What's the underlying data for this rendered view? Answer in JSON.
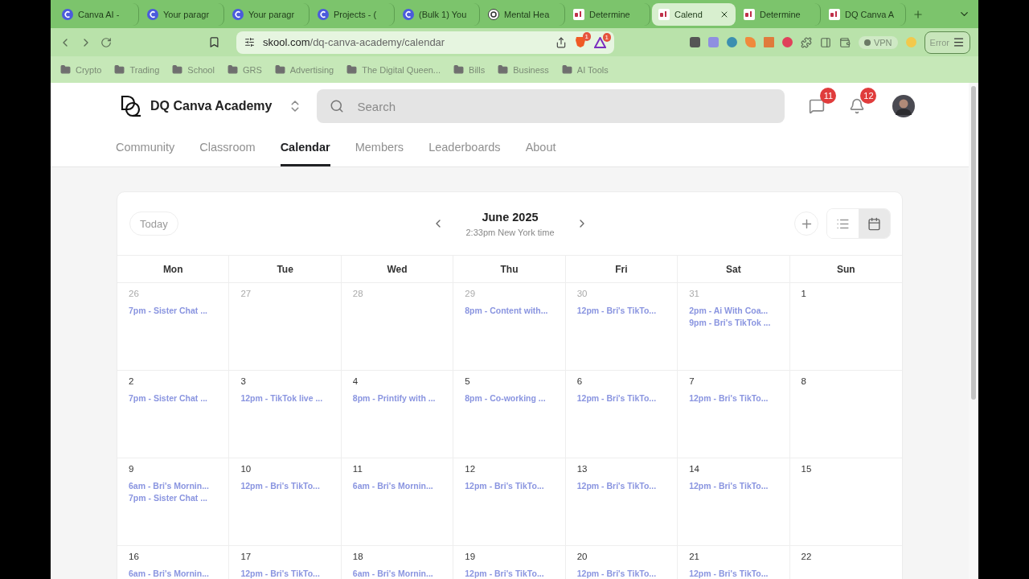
{
  "browser": {
    "tabs": [
      {
        "label": "Canva AI -",
        "kind": "circle",
        "selected": false
      },
      {
        "label": "Your paragr",
        "kind": "circle",
        "selected": false
      },
      {
        "label": "Your paragr",
        "kind": "circle",
        "selected": false
      },
      {
        "label": "Projects - (",
        "kind": "circle",
        "selected": false
      },
      {
        "label": "(Bulk 1) You",
        "kind": "circle",
        "selected": false
      },
      {
        "label": "Mental Hea",
        "kind": "swirl",
        "selected": false
      },
      {
        "label": "Determine",
        "kind": "square",
        "selected": false
      },
      {
        "label": "Calend",
        "kind": "square",
        "selected": true
      },
      {
        "label": "Determine",
        "kind": "square",
        "selected": false
      },
      {
        "label": "DQ Canva A",
        "kind": "square",
        "selected": false
      }
    ],
    "url_host": "skool.com",
    "url_path": "/dq-canva-academy/calendar",
    "shield_badge": "1",
    "rewards_badge": "1",
    "vpn_label": "VPN",
    "error_label": "Error",
    "bookmarks": [
      "Crypto",
      "Trading",
      "School",
      "GRS",
      "Advertising",
      "The Digital Queen...",
      "Bills",
      "Business",
      "AI Tools"
    ]
  },
  "header": {
    "group_name": "DQ Canva Academy",
    "search_placeholder": "Search",
    "chat_badge": "11",
    "notification_badge": "12"
  },
  "nav": [
    {
      "label": "Community",
      "selected": false
    },
    {
      "label": "Classroom",
      "selected": false
    },
    {
      "label": "Calendar",
      "selected": true
    },
    {
      "label": "Members",
      "selected": false
    },
    {
      "label": "Leaderboards",
      "selected": false
    },
    {
      "label": "About",
      "selected": false
    }
  ],
  "calendar": {
    "today_label": "Today",
    "month": "June 2025",
    "time_note": "2:33pm New York time",
    "views": [
      {
        "kind": "list",
        "selected": false
      },
      {
        "kind": "calendar",
        "selected": true
      }
    ],
    "weekdays": [
      "Mon",
      "Tue",
      "Wed",
      "Thu",
      "Fri",
      "Sat",
      "Sun"
    ],
    "weeks": [
      [
        {
          "day": "26",
          "muted": true,
          "events": [
            "7pm - Sister Chat ..."
          ]
        },
        {
          "day": "27",
          "muted": true
        },
        {
          "day": "28",
          "muted": true
        },
        {
          "day": "29",
          "muted": true,
          "events": [
            "8pm - Content with..."
          ]
        },
        {
          "day": "30",
          "muted": true,
          "events": [
            "12pm - Bri's TikTo..."
          ]
        },
        {
          "day": "31",
          "muted": true,
          "events": [
            "2pm - Ai With Coa...",
            "9pm - Bri's TikTok ..."
          ]
        },
        {
          "day": "1",
          "muted": false
        }
      ],
      [
        {
          "day": "2",
          "muted": false,
          "events": [
            "7pm - Sister Chat ..."
          ]
        },
        {
          "day": "3",
          "muted": false,
          "events": [
            "12pm - TikTok live ..."
          ]
        },
        {
          "day": "4",
          "muted": false,
          "events": [
            "8pm - Printify with ..."
          ]
        },
        {
          "day": "5",
          "muted": false,
          "events": [
            "8pm - Co-working ..."
          ]
        },
        {
          "day": "6",
          "muted": false,
          "events": [
            "12pm - Bri's TikTo..."
          ]
        },
        {
          "day": "7",
          "muted": false,
          "events": [
            "12pm - Bri's TikTo..."
          ]
        },
        {
          "day": "8",
          "muted": false
        }
      ],
      [
        {
          "day": "9",
          "muted": false,
          "events": [
            "6am - Bri's Mornin...",
            "7pm - Sister Chat ..."
          ]
        },
        {
          "day": "10",
          "muted": false,
          "events": [
            "12pm - Bri's TikTo..."
          ]
        },
        {
          "day": "11",
          "muted": false,
          "events": [
            "6am - Bri's Mornin..."
          ]
        },
        {
          "day": "12",
          "muted": false,
          "events": [
            "12pm - Bri's TikTo..."
          ]
        },
        {
          "day": "13",
          "muted": false,
          "events": [
            "12pm - Bri's TikTo..."
          ]
        },
        {
          "day": "14",
          "muted": false,
          "events": [
            "12pm - Bri's TikTo..."
          ]
        },
        {
          "day": "15",
          "muted": false
        }
      ],
      [
        {
          "day": "16",
          "muted": false,
          "events": [
            "6am - Bri's Mornin..."
          ]
        },
        {
          "day": "17",
          "muted": false,
          "events": [
            "12pm - Bri's TikTo..."
          ]
        },
        {
          "day": "18",
          "muted": false,
          "events": [
            "6am - Bri's Mornin..."
          ]
        },
        {
          "day": "19",
          "muted": false,
          "events": [
            "12pm - Bri's TikTo..."
          ]
        },
        {
          "day": "20",
          "muted": false,
          "events": [
            "12pm - Bri's TikTo..."
          ]
        },
        {
          "day": "21",
          "muted": false,
          "events": [
            "12pm - Bri's TikTo..."
          ]
        },
        {
          "day": "22",
          "muted": false
        }
      ]
    ]
  }
}
